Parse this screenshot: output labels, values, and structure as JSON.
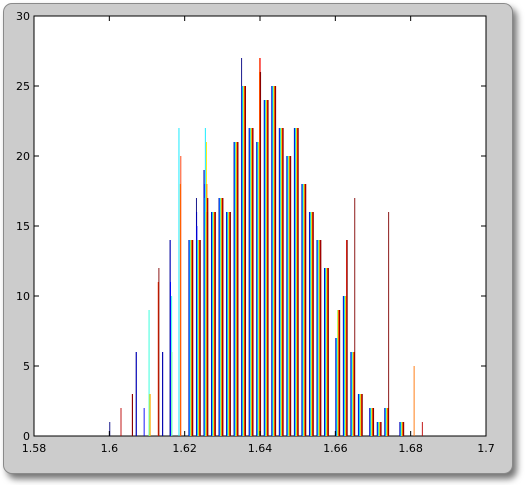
{
  "figure": {
    "background": "#cccccc",
    "axes_background": "#ffffff"
  },
  "chart_data": {
    "type": "bar",
    "title": "",
    "xlabel": "",
    "ylabel": "",
    "xlim": [
      1.58,
      1.7
    ],
    "ylim": [
      0,
      30
    ],
    "xticks": [
      1.58,
      1.6,
      1.62,
      1.64,
      1.66,
      1.68,
      1.7
    ],
    "xtick_labels": [
      "1.58",
      "1.6",
      "1.62",
      "1.64",
      "1.66",
      "1.68",
      "1.7"
    ],
    "yticks": [
      0,
      5,
      10,
      15,
      20,
      25,
      30
    ],
    "ytick_labels": [
      "0",
      "5",
      "10",
      "15",
      "20",
      "25",
      "30"
    ],
    "grid": false,
    "legend": "none",
    "colormap": "jet",
    "group_count": 18,
    "bar_width": 0.0005,
    "bars": [
      {
        "x": 1.6,
        "values": [
          1,
          0,
          0,
          0,
          0,
          0,
          0,
          0,
          0,
          0,
          0,
          0,
          0,
          0,
          0,
          0,
          0,
          0
        ]
      },
      {
        "x": 1.602,
        "values": [
          0,
          0,
          0,
          0,
          0,
          0,
          0,
          0,
          0,
          0,
          0,
          0,
          0,
          0,
          0,
          0,
          2,
          0
        ]
      },
      {
        "x": 1.605,
        "values": [
          0,
          0,
          0,
          0,
          0,
          0,
          0,
          0,
          0,
          0,
          0,
          0,
          0,
          0,
          0,
          0,
          3,
          3
        ]
      },
      {
        "x": 1.607,
        "values": [
          6,
          6,
          0,
          0,
          0,
          0,
          0,
          0,
          0,
          0,
          0,
          0,
          0,
          0,
          0,
          0,
          0,
          0
        ]
      },
      {
        "x": 1.609,
        "values": [
          0,
          0,
          2,
          0,
          0,
          0,
          0,
          0,
          0,
          0,
          0,
          0,
          0,
          0,
          0,
          0,
          0,
          0
        ]
      },
      {
        "x": 1.61,
        "values": [
          0,
          0,
          0,
          0,
          0,
          0,
          0,
          9,
          3,
          0,
          0,
          3,
          3,
          0,
          0,
          0,
          0,
          0
        ]
      },
      {
        "x": 1.612,
        "values": [
          0,
          0,
          0,
          0,
          0,
          0,
          0,
          0,
          0,
          0,
          0,
          0,
          0,
          0,
          11,
          0,
          0,
          12
        ]
      },
      {
        "x": 1.614,
        "values": [
          6,
          6,
          0,
          0,
          0,
          0,
          0,
          0,
          0,
          0,
          0,
          0,
          0,
          0,
          0,
          0,
          0,
          0
        ]
      },
      {
        "x": 1.616,
        "values": [
          14,
          14,
          11,
          0,
          0,
          0,
          0,
          10,
          6,
          0,
          0,
          0,
          0,
          0,
          0,
          0,
          0,
          0
        ]
      },
      {
        "x": 1.618,
        "values": [
          0,
          0,
          0,
          0,
          0,
          0,
          22,
          0,
          0,
          0,
          0,
          0,
          18,
          0,
          20,
          0,
          0,
          0
        ]
      },
      {
        "x": 1.62,
        "values": [
          0,
          0,
          0,
          0,
          0,
          0,
          0,
          0,
          0,
          0,
          0,
          0,
          0,
          0,
          0,
          0,
          0,
          0
        ]
      },
      {
        "x": 1.621,
        "values": [
          14,
          14,
          14,
          14,
          14,
          14,
          14,
          14,
          14,
          14,
          14,
          14,
          14,
          14,
          14,
          14,
          14,
          14
        ]
      },
      {
        "x": 1.623,
        "values": [
          17,
          16,
          15,
          14,
          14,
          14,
          14,
          14,
          14,
          14,
          14,
          14,
          14,
          14,
          14,
          14,
          14,
          14
        ]
      },
      {
        "x": 1.625,
        "values": [
          19,
          19,
          18,
          17,
          17,
          17,
          22,
          16,
          16,
          15,
          18,
          21,
          16,
          18,
          16,
          17,
          16,
          17
        ]
      },
      {
        "x": 1.627,
        "values": [
          16,
          16,
          16,
          16,
          16,
          16,
          16,
          16,
          16,
          16,
          16,
          16,
          16,
          16,
          16,
          16,
          16,
          16
        ]
      },
      {
        "x": 1.629,
        "values": [
          17,
          17,
          17,
          17,
          17,
          17,
          17,
          17,
          17,
          17,
          17,
          17,
          17,
          17,
          17,
          17,
          17,
          17
        ]
      },
      {
        "x": 1.631,
        "values": [
          16,
          16,
          16,
          16,
          16,
          16,
          16,
          16,
          16,
          16,
          16,
          16,
          16,
          16,
          16,
          16,
          16,
          16
        ]
      },
      {
        "x": 1.633,
        "values": [
          21,
          21,
          21,
          21,
          21,
          21,
          21,
          21,
          21,
          21,
          21,
          21,
          21,
          21,
          21,
          21,
          21,
          21
        ]
      },
      {
        "x": 1.635,
        "values": [
          27,
          24,
          25,
          25,
          25,
          25,
          25,
          25,
          25,
          25,
          25,
          25,
          25,
          25,
          25,
          25,
          25,
          25
        ]
      },
      {
        "x": 1.637,
        "values": [
          22,
          22,
          22,
          22,
          22,
          22,
          22,
          22,
          22,
          22,
          22,
          22,
          22,
          22,
          22,
          22,
          22,
          22
        ]
      },
      {
        "x": 1.639,
        "values": [
          21,
          21,
          21,
          21,
          21,
          21,
          21,
          21,
          21,
          21,
          21,
          21,
          26,
          27,
          27,
          27,
          26,
          26
        ]
      },
      {
        "x": 1.641,
        "values": [
          24,
          24,
          24,
          24,
          24,
          24,
          24,
          24,
          24,
          24,
          24,
          24,
          24,
          24,
          24,
          24,
          24,
          24
        ]
      },
      {
        "x": 1.643,
        "values": [
          25,
          25,
          25,
          25,
          25,
          25,
          25,
          25,
          25,
          25,
          25,
          25,
          25,
          25,
          25,
          25,
          25,
          25
        ]
      },
      {
        "x": 1.645,
        "values": [
          22,
          22,
          22,
          22,
          22,
          22,
          22,
          22,
          22,
          22,
          22,
          22,
          22,
          22,
          22,
          22,
          22,
          22
        ]
      },
      {
        "x": 1.647,
        "values": [
          20,
          20,
          20,
          20,
          20,
          20,
          20,
          20,
          20,
          20,
          20,
          20,
          20,
          20,
          20,
          20,
          20,
          20
        ]
      },
      {
        "x": 1.649,
        "values": [
          22,
          22,
          22,
          22,
          22,
          22,
          22,
          22,
          22,
          22,
          22,
          22,
          22,
          22,
          22,
          22,
          22,
          22
        ]
      },
      {
        "x": 1.651,
        "values": [
          18,
          18,
          18,
          18,
          18,
          18,
          18,
          18,
          18,
          18,
          18,
          18,
          18,
          18,
          18,
          18,
          18,
          18
        ]
      },
      {
        "x": 1.653,
        "values": [
          16,
          16,
          16,
          16,
          16,
          16,
          16,
          16,
          16,
          16,
          16,
          16,
          16,
          16,
          16,
          16,
          16,
          16
        ]
      },
      {
        "x": 1.655,
        "values": [
          14,
          14,
          14,
          14,
          14,
          14,
          14,
          14,
          14,
          14,
          14,
          14,
          14,
          14,
          14,
          14,
          14,
          14
        ]
      },
      {
        "x": 1.657,
        "values": [
          12,
          12,
          12,
          12,
          12,
          12,
          12,
          12,
          12,
          12,
          12,
          12,
          12,
          12,
          12,
          12,
          12,
          12
        ]
      },
      {
        "x": 1.659,
        "values": [
          0,
          0,
          0,
          0,
          0,
          0,
          0,
          0,
          0,
          0,
          0,
          0,
          0,
          0,
          0,
          0,
          0,
          0
        ]
      },
      {
        "x": 1.66,
        "values": [
          7,
          7,
          7,
          7,
          7,
          7,
          7,
          7,
          9,
          9,
          9,
          9,
          9,
          9,
          9,
          9,
          9,
          9
        ]
      },
      {
        "x": 1.662,
        "values": [
          10,
          10,
          10,
          10,
          10,
          10,
          10,
          10,
          10,
          10,
          10,
          10,
          10,
          10,
          14,
          14,
          14,
          14
        ]
      },
      {
        "x": 1.664,
        "values": [
          6,
          6,
          6,
          6,
          6,
          6,
          6,
          6,
          6,
          6,
          6,
          6,
          6,
          6,
          6,
          6,
          6,
          17
        ]
      },
      {
        "x": 1.666,
        "values": [
          3,
          3,
          3,
          3,
          3,
          3,
          3,
          3,
          3,
          3,
          3,
          3,
          3,
          3,
          3,
          3,
          3,
          3
        ]
      },
      {
        "x": 1.668,
        "values": [
          0,
          0,
          0,
          0,
          0,
          0,
          0,
          0,
          0,
          0,
          0,
          0,
          0,
          0,
          0,
          0,
          0,
          0
        ]
      },
      {
        "x": 1.669,
        "values": [
          2,
          2,
          2,
          2,
          2,
          2,
          2,
          2,
          2,
          2,
          2,
          2,
          2,
          2,
          2,
          2,
          2,
          2
        ]
      },
      {
        "x": 1.671,
        "values": [
          1,
          1,
          1,
          1,
          1,
          1,
          1,
          1,
          1,
          1,
          1,
          1,
          1,
          1,
          1,
          1,
          1,
          1
        ]
      },
      {
        "x": 1.673,
        "values": [
          2,
          2,
          2,
          2,
          2,
          2,
          2,
          2,
          2,
          2,
          2,
          2,
          2,
          2,
          2,
          2,
          2,
          16
        ]
      },
      {
        "x": 1.675,
        "values": [
          0,
          0,
          0,
          0,
          0,
          0,
          0,
          0,
          0,
          0,
          0,
          0,
          0,
          0,
          0,
          0,
          0,
          0
        ]
      },
      {
        "x": 1.677,
        "values": [
          1,
          1,
          1,
          1,
          1,
          1,
          1,
          1,
          1,
          1,
          1,
          1,
          1,
          1,
          1,
          1,
          1,
          1
        ]
      },
      {
        "x": 1.679,
        "values": [
          0,
          0,
          0,
          0,
          0,
          0,
          0,
          0,
          0,
          0,
          0,
          0,
          0,
          0,
          0,
          0,
          0,
          0
        ]
      },
      {
        "x": 1.68,
        "values": [
          0,
          0,
          0,
          0,
          0,
          0,
          0,
          0,
          0,
          0,
          0,
          0,
          0,
          5,
          0,
          0,
          0,
          0
        ]
      },
      {
        "x": 1.682,
        "values": [
          0,
          0,
          0,
          0,
          0,
          0,
          0,
          0,
          0,
          0,
          0,
          0,
          0,
          0,
          0,
          0,
          1,
          0
        ]
      }
    ]
  }
}
